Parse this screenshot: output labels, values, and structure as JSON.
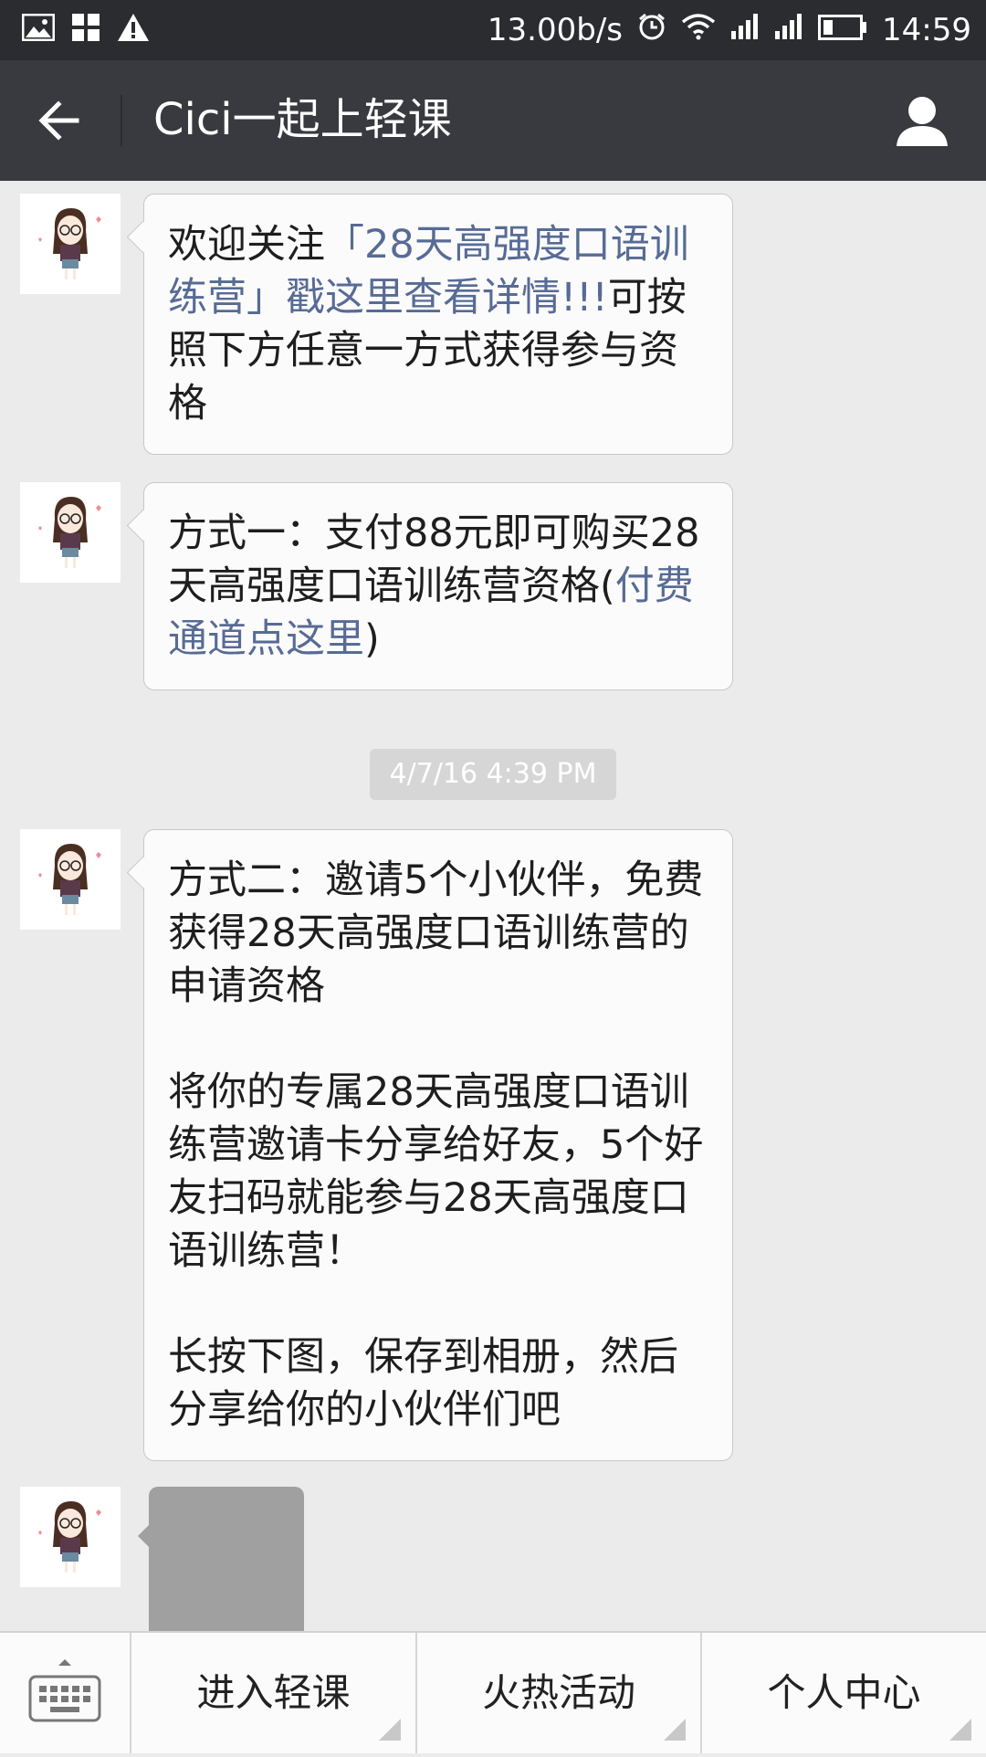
{
  "status_bar": {
    "network_speed": "13.00b/s",
    "time": "14:59",
    "icons": [
      "image-icon",
      "apps-icon",
      "warning-icon",
      "alarm-icon",
      "wifi-icon",
      "signal-icon",
      "signal-icon",
      "battery-icon"
    ]
  },
  "header": {
    "title": "Cici一起上轻课",
    "back_icon": "back-arrow-icon",
    "profile_icon": "person-icon"
  },
  "messages": [
    {
      "segments": [
        {
          "text": "欢迎关注",
          "link": false
        },
        {
          "text": "「28天高强度口语训练营」戳这里查看详情!!!",
          "link": true
        },
        {
          "text": "可按照下方任意一方式获得参与资格",
          "link": false
        }
      ]
    },
    {
      "segments": [
        {
          "text": "方式一：支付88元即可购买28天高强度口语训练营资格(",
          "link": false
        },
        {
          "text": "付费通道点这里",
          "link": true
        },
        {
          "text": ")",
          "link": false
        }
      ]
    },
    {
      "paragraphs": [
        "方式二：邀请5个小伙伴，免费获得28天高强度口语训练营的申请资格",
        "将你的专属28天高强度口语训练营邀请卡分享给好友，5个好友扫码就能参与28天高强度口语训练营！",
        "长按下图，保存到相册，然后分享给你的小伙伴们吧"
      ]
    }
  ],
  "timestamp": "4/7/16 4:39 PM",
  "bottom_menu": {
    "keyboard_icon": "keyboard-icon",
    "items": [
      "进入轻课",
      "火热活动",
      "个人中心"
    ]
  }
}
